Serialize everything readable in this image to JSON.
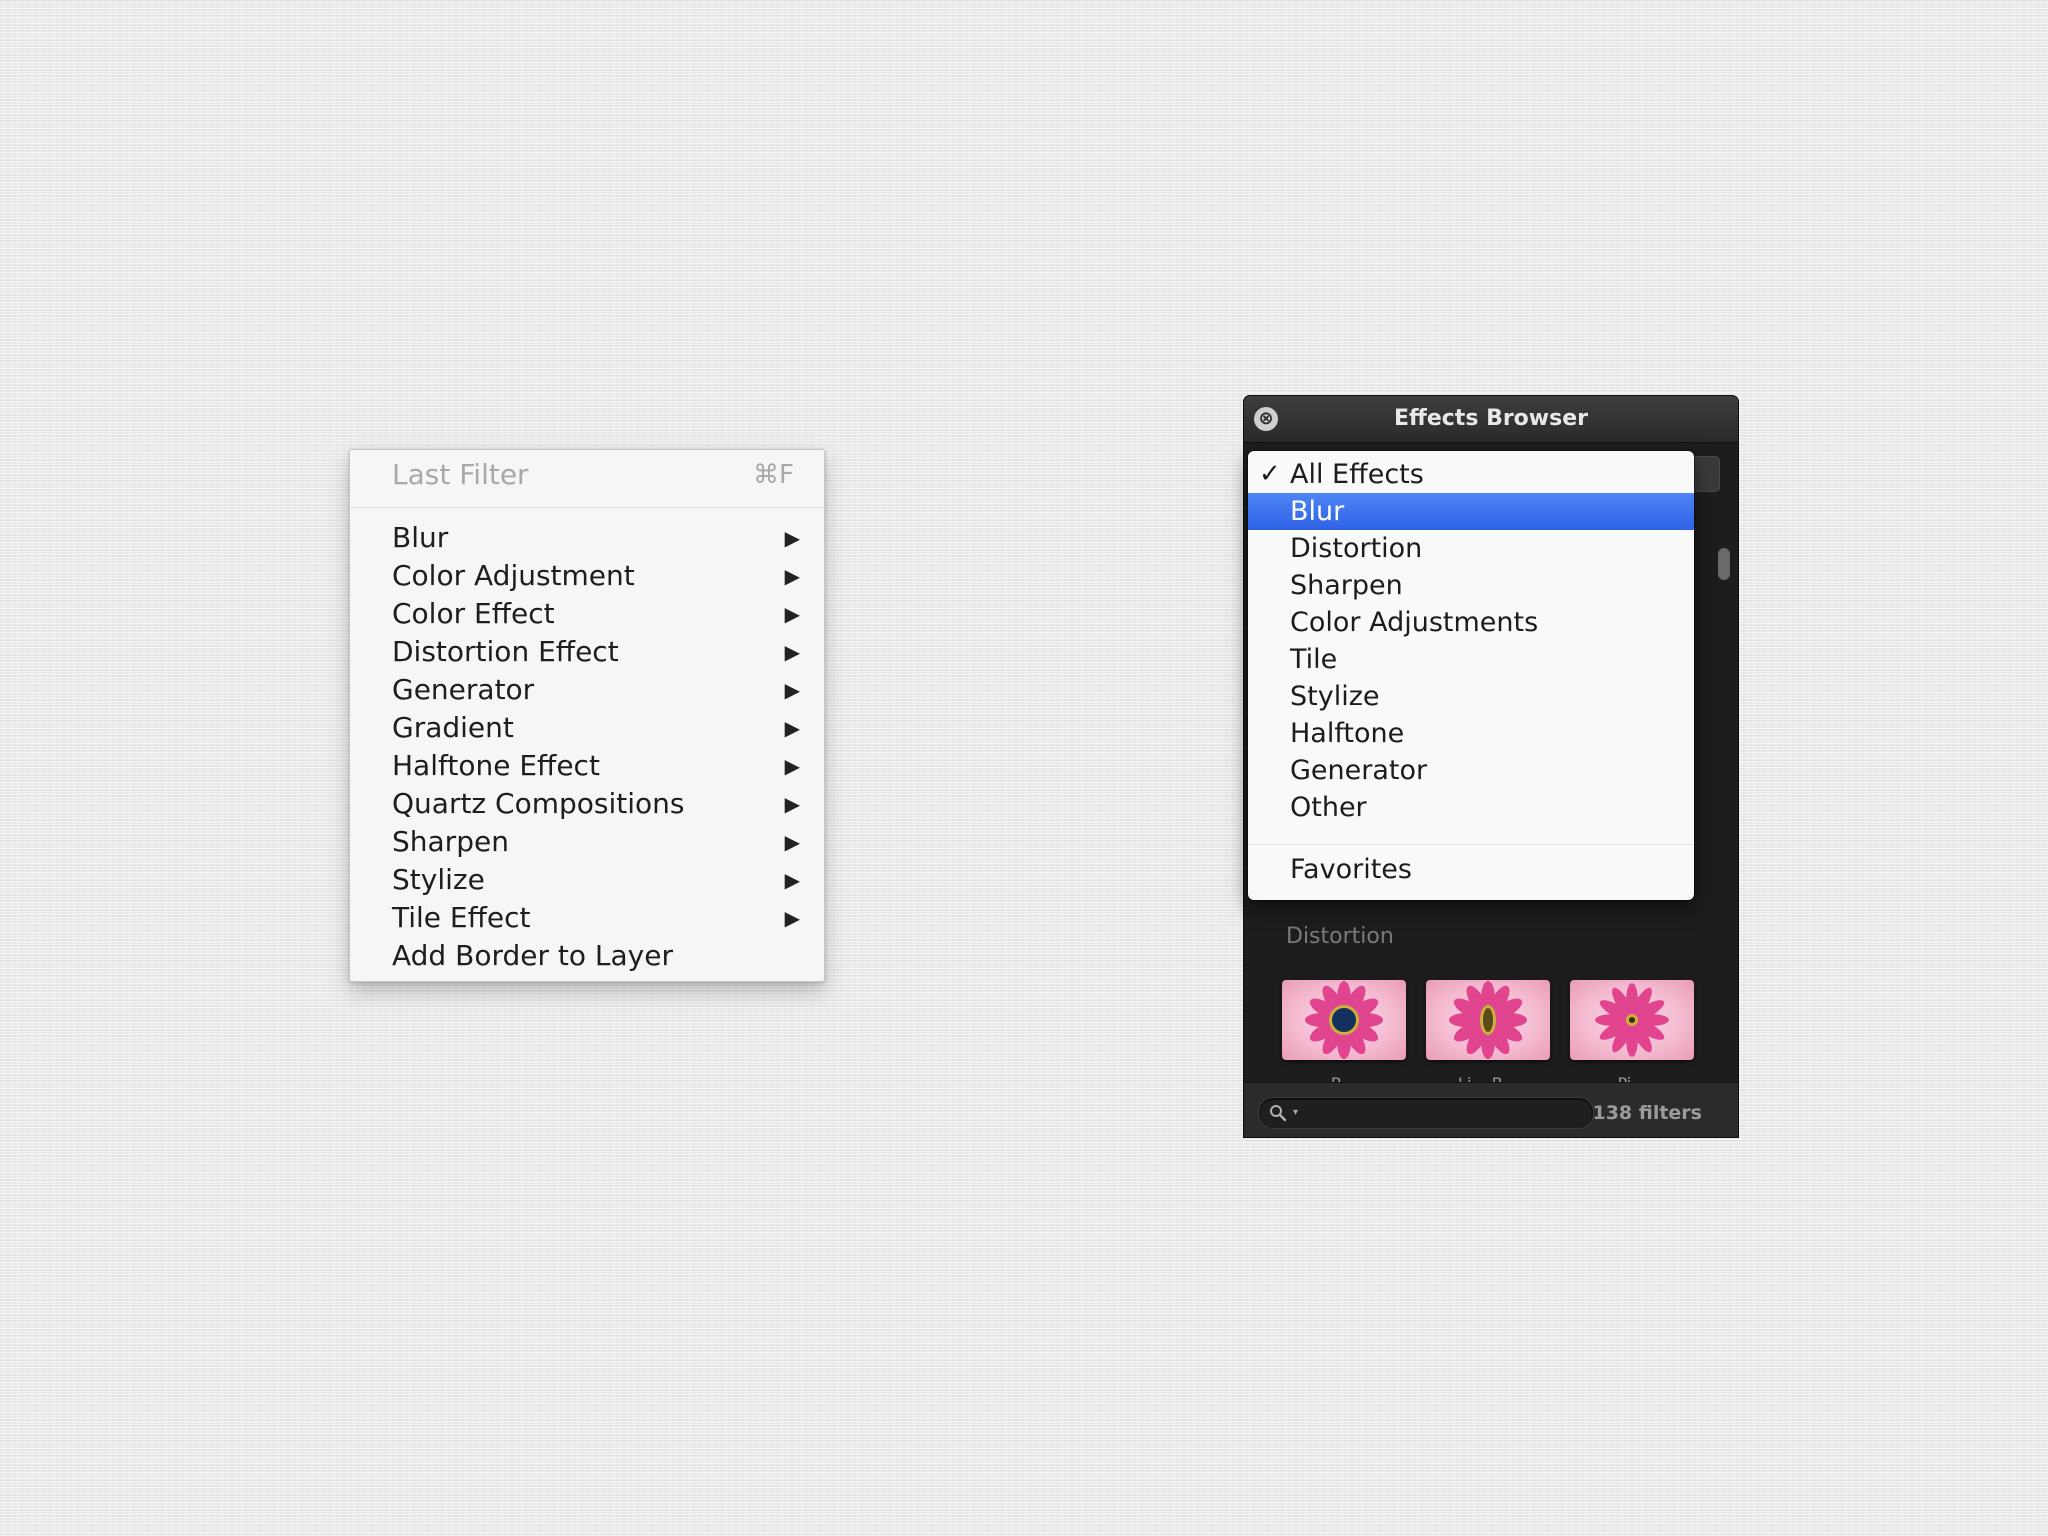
{
  "filter_menu": {
    "last_filter": {
      "label": "Last Filter",
      "shortcut": "⌘F"
    },
    "items": [
      {
        "label": "Blur",
        "submenu": true
      },
      {
        "label": "Color Adjustment",
        "submenu": true
      },
      {
        "label": "Color Effect",
        "submenu": true
      },
      {
        "label": "Distortion Effect",
        "submenu": true
      },
      {
        "label": "Generator",
        "submenu": true
      },
      {
        "label": "Gradient",
        "submenu": true
      },
      {
        "label": "Halftone Effect",
        "submenu": true
      },
      {
        "label": "Quartz Compositions",
        "submenu": true
      },
      {
        "label": "Sharpen",
        "submenu": true
      },
      {
        "label": "Stylize",
        "submenu": true
      },
      {
        "label": "Tile Effect",
        "submenu": true
      },
      {
        "label": "Add Border to Layer",
        "submenu": false
      }
    ],
    "submenu_arrow": "▶"
  },
  "effects_browser": {
    "title": "Effects Browser",
    "close_icon": "⊗",
    "category_dropdown": {
      "checkmark": "✓",
      "checked": "All Effects",
      "selected": "Blur",
      "items": [
        "All Effects",
        "Blur",
        "Distortion",
        "Sharpen",
        "Color Adjustments",
        "Tile",
        "Stylize",
        "Halftone",
        "Generator",
        "Other"
      ],
      "favorites": "Favorites",
      "highlight_color": "#3a6fe9"
    },
    "section_label": "Distortion",
    "thumbnails": [
      {
        "icon": "pink-flower-bump-icon",
        "caption": "B..."
      },
      {
        "icon": "pink-flower-linear-bump-icon",
        "caption": "Li... B..."
      },
      {
        "icon": "pink-flower-pinch-icon",
        "caption": "Pi..."
      }
    ],
    "search": {
      "icon": "magnifier-icon",
      "caret": "▾"
    },
    "filter_count": "138 filters"
  }
}
